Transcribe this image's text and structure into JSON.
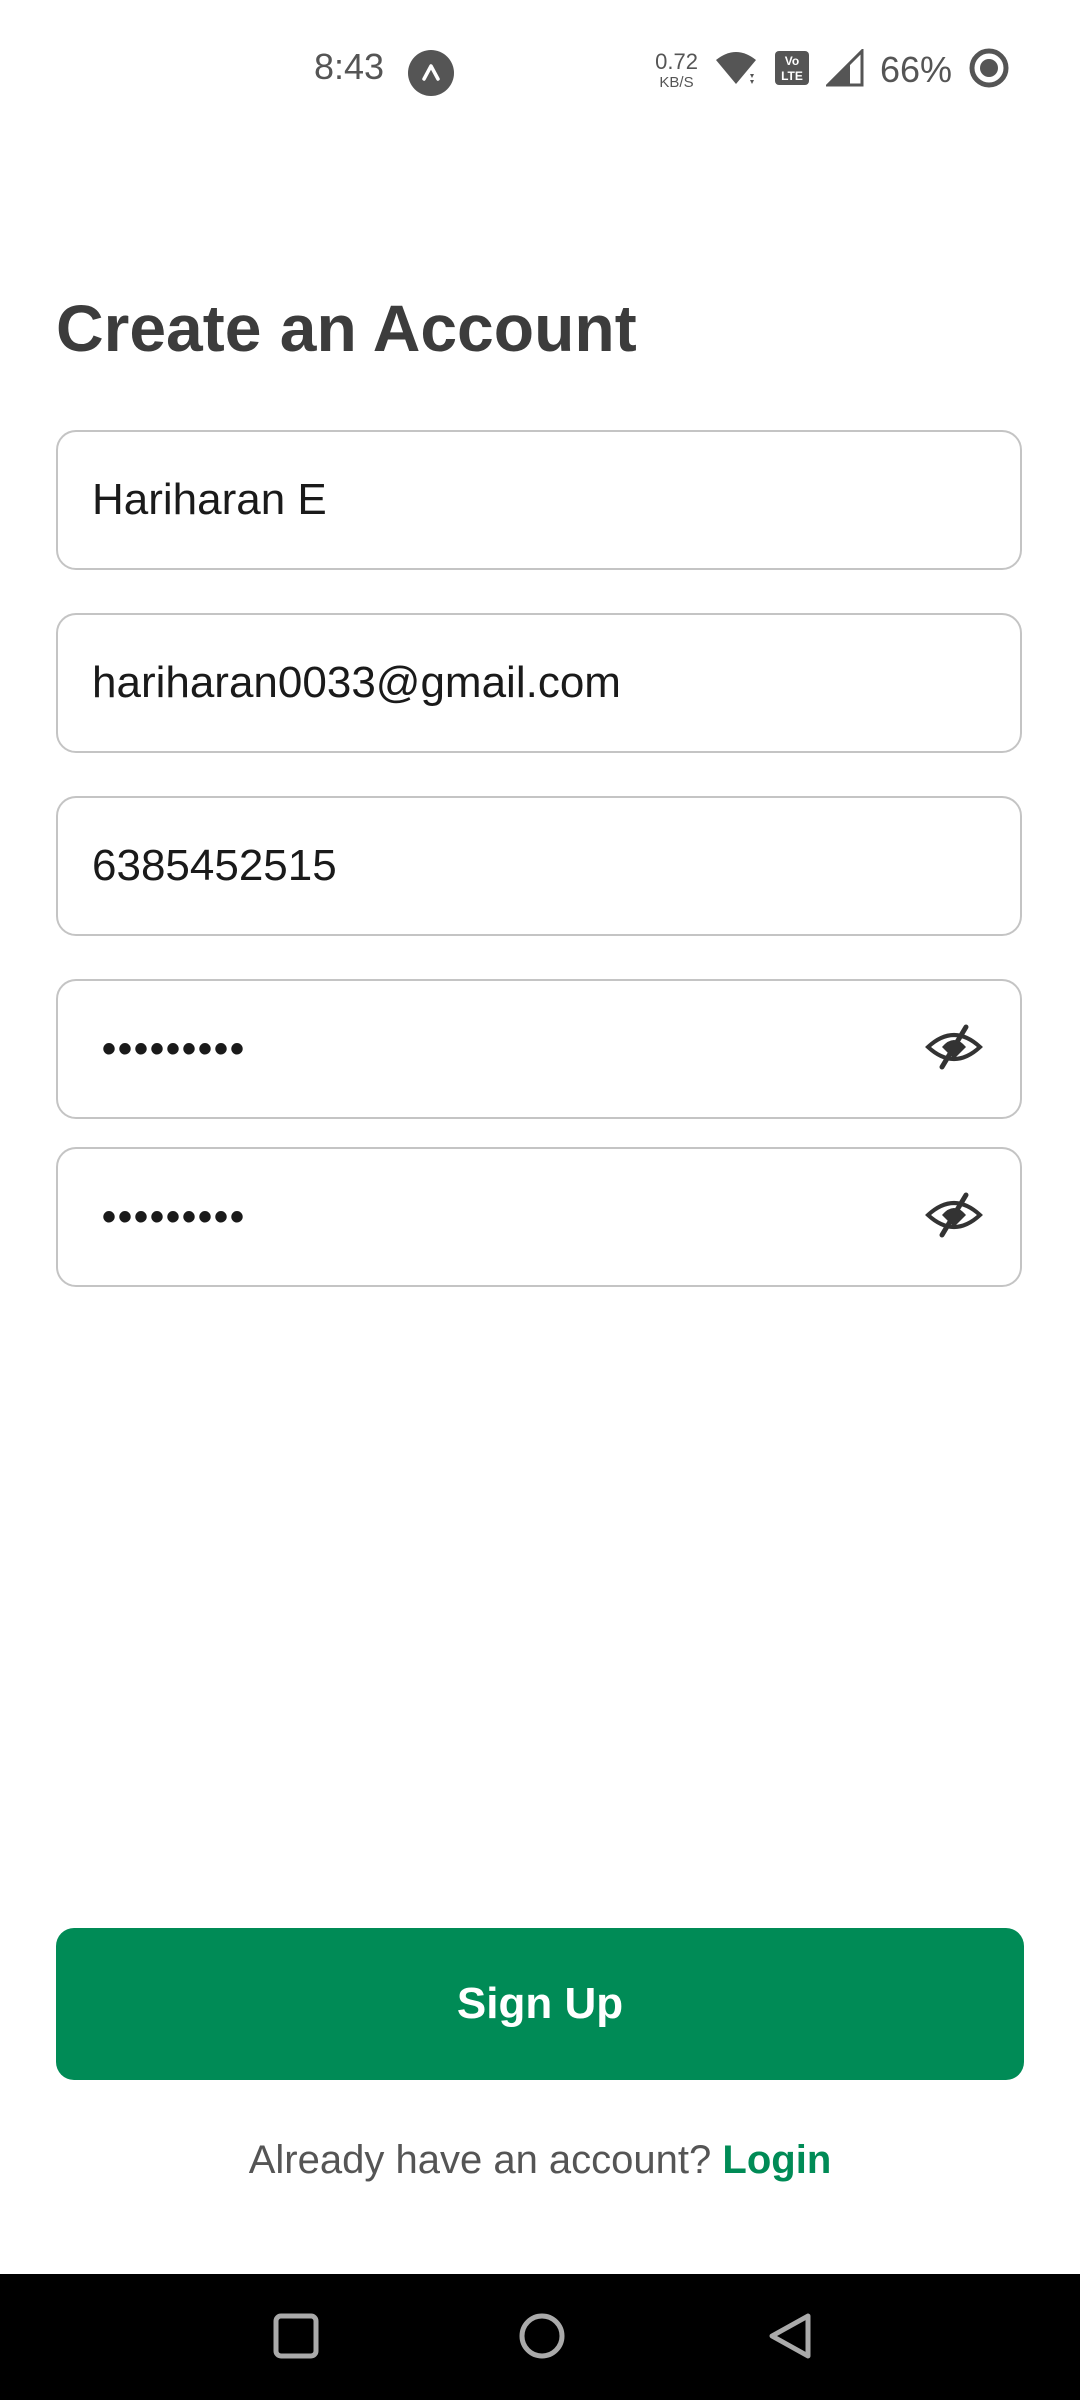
{
  "status_bar": {
    "time": "8:43",
    "net_speed_value": "0.72",
    "net_speed_unit": "KB/S",
    "battery_percent": "66%",
    "icons": [
      "app-notification-icon",
      "wifi-icon",
      "volte-icon",
      "signal-icon",
      "battery-icon"
    ]
  },
  "form": {
    "title": "Create an Account",
    "name_value": "Hariharan E",
    "email_value": "hariharan0033@gmail.com",
    "phone_value": "6385452515",
    "password_masked": "•••••••••",
    "confirm_password_masked": "•••••••••"
  },
  "actions": {
    "signup_label": "Sign Up",
    "login_prompt": "Already have an account?",
    "login_label": "Login"
  },
  "nav": {
    "icons": [
      "recent-apps-icon",
      "home-icon",
      "back-icon"
    ]
  },
  "colors": {
    "accent": "#008b56",
    "title": "#3c3c3c",
    "border": "#c4c4c4",
    "nav_bar": "#000000"
  }
}
